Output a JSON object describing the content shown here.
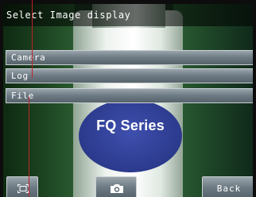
{
  "title": "Select Image display",
  "menu": {
    "items": [
      {
        "label": "Camera"
      },
      {
        "label": "Log"
      },
      {
        "label": "File"
      }
    ]
  },
  "image": {
    "label_text": "FQ Series"
  },
  "buttons": {
    "fit_icon": "fit-screen-icon",
    "camera_icon": "camera-icon",
    "back_label": "Back"
  },
  "colors": {
    "callout": "#c0202a",
    "label_blue": "#2b3a8c",
    "menu_button": "#6d7a83"
  }
}
